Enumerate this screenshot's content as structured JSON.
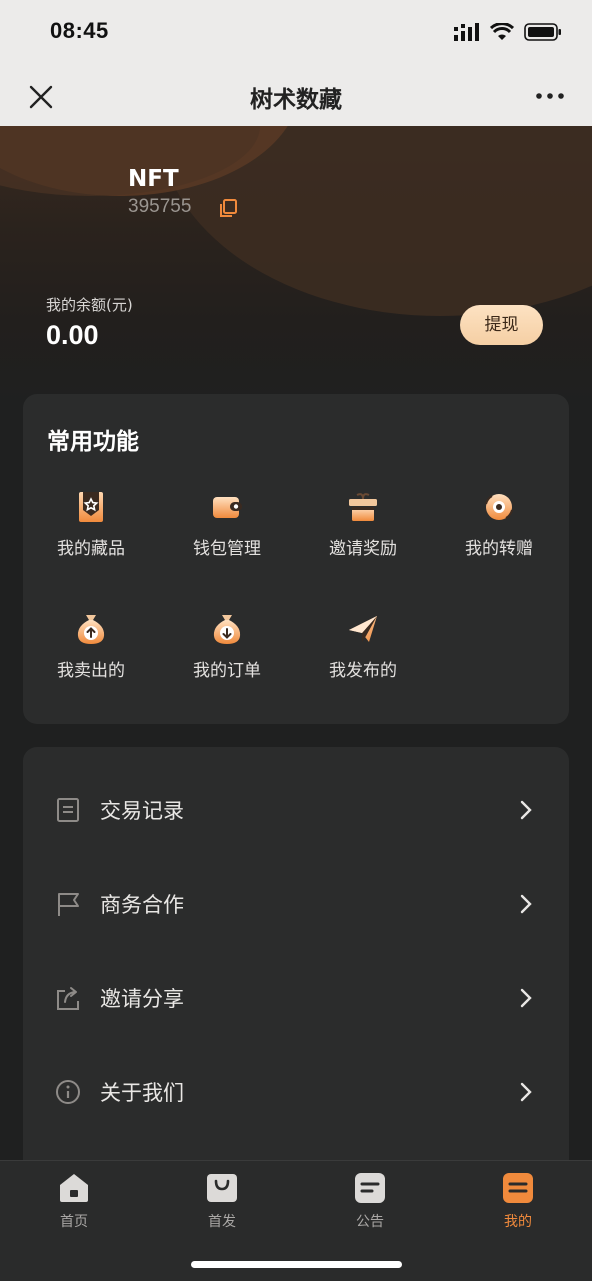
{
  "status_bar": {
    "time": "08:45"
  },
  "nav": {
    "title": "树术数藏"
  },
  "user": {
    "name": "NFT",
    "id": "395755"
  },
  "balance": {
    "label": "我的余额(元)",
    "value": "0.00",
    "withdraw_label": "提现"
  },
  "functions": {
    "title": "常用功能",
    "items": [
      {
        "label": "我的藏品",
        "icon": "collection-icon"
      },
      {
        "label": "钱包管理",
        "icon": "wallet-icon"
      },
      {
        "label": "邀请奖励",
        "icon": "gift-icon"
      },
      {
        "label": "我的转赠",
        "icon": "transfer-icon"
      },
      {
        "label": "我卖出的",
        "icon": "sold-bag-icon"
      },
      {
        "label": "我的订单",
        "icon": "order-bag-icon"
      },
      {
        "label": "我发布的",
        "icon": "paper-plane-icon"
      }
    ]
  },
  "menu": [
    {
      "label": "交易记录",
      "icon": "document-icon"
    },
    {
      "label": "商务合作",
      "icon": "flag-icon"
    },
    {
      "label": "邀请分享",
      "icon": "share-icon"
    },
    {
      "label": "关于我们",
      "icon": "info-icon"
    }
  ],
  "tabs": [
    {
      "label": "首页",
      "icon": "home-icon"
    },
    {
      "label": "首发",
      "icon": "shopping-bag-icon"
    },
    {
      "label": "公告",
      "icon": "notice-icon"
    },
    {
      "label": "我的",
      "icon": "profile-icon",
      "active": true
    }
  ],
  "colors": {
    "accent": "#f08a3c",
    "card": "#2b2c2c",
    "background": "#1f2020",
    "withdraw": "#f8d6ae"
  }
}
